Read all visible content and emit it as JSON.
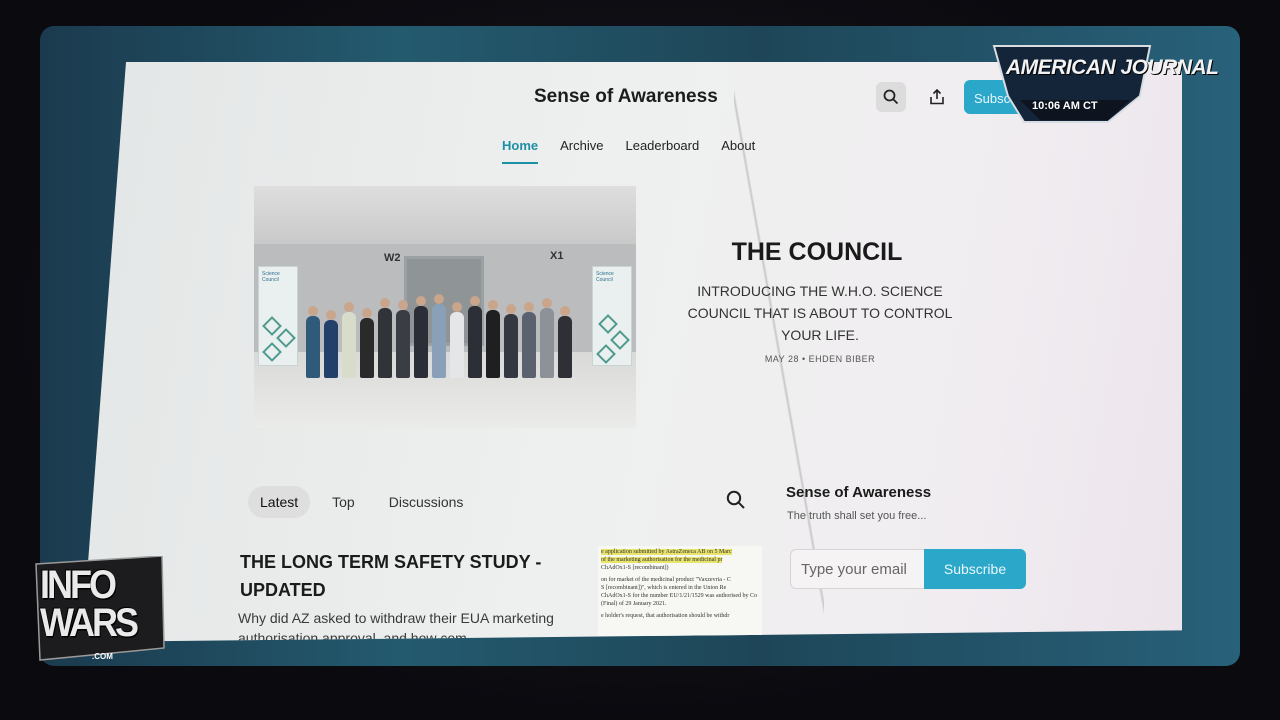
{
  "site": {
    "title": "Sense of Awareness",
    "subscribe_label": "Subsc"
  },
  "nav": {
    "items": [
      "Home",
      "Archive",
      "Leaderboard",
      "About"
    ]
  },
  "hero": {
    "title": "THE COUNCIL",
    "subtitle": "INTRODUCING THE W.H.O. SCIENCE COUNCIL THAT IS ABOUT TO CONTROL YOUR LIFE.",
    "meta": "MAY 28 • EHDEN BIBER",
    "image": {
      "sign_left": "W2",
      "sign_right": "X1",
      "banner_text": "Science Council"
    }
  },
  "tabs": {
    "items": [
      "Latest",
      "Top",
      "Discussions"
    ]
  },
  "post": {
    "title": "THE LONG TERM SAFETY STUDY - UPDATED",
    "description": "Why did AZ asked to withdraw their EUA marketing authorisation approval, and how com",
    "thumb_lines": [
      "e application submitted by AstraZeneca AB on 5 Marc",
      "of the marketing authorisation for the medicinal pr",
      "ChAdOx1-S [recombinant])",
      "on for market of the medicinal product \"Vaxzevria - C",
      "S [recombinant])\", which is entered in the Union Re",
      "ChAdOx1-S for the number EU/1/21/1529 was authorised by Co",
      "(Final) of 29 January 2021.",
      "e holder's request, that authorisation should be withdr"
    ]
  },
  "sidebar": {
    "name": "Sense of Awareness",
    "tagline": "The truth shall set you free...",
    "email_placeholder": "Type your email",
    "subscribe_label": "Subscribe"
  },
  "overlay": {
    "network_title": "AMERICAN JOURNAL",
    "time": "10:06 AM CT",
    "logo_line1": "INFO",
    "logo_line2": "WARS",
    "logo_domain": ".COM"
  },
  "colors": {
    "accent": "#2aa7c9",
    "nav_active": "#1f8fa6"
  }
}
